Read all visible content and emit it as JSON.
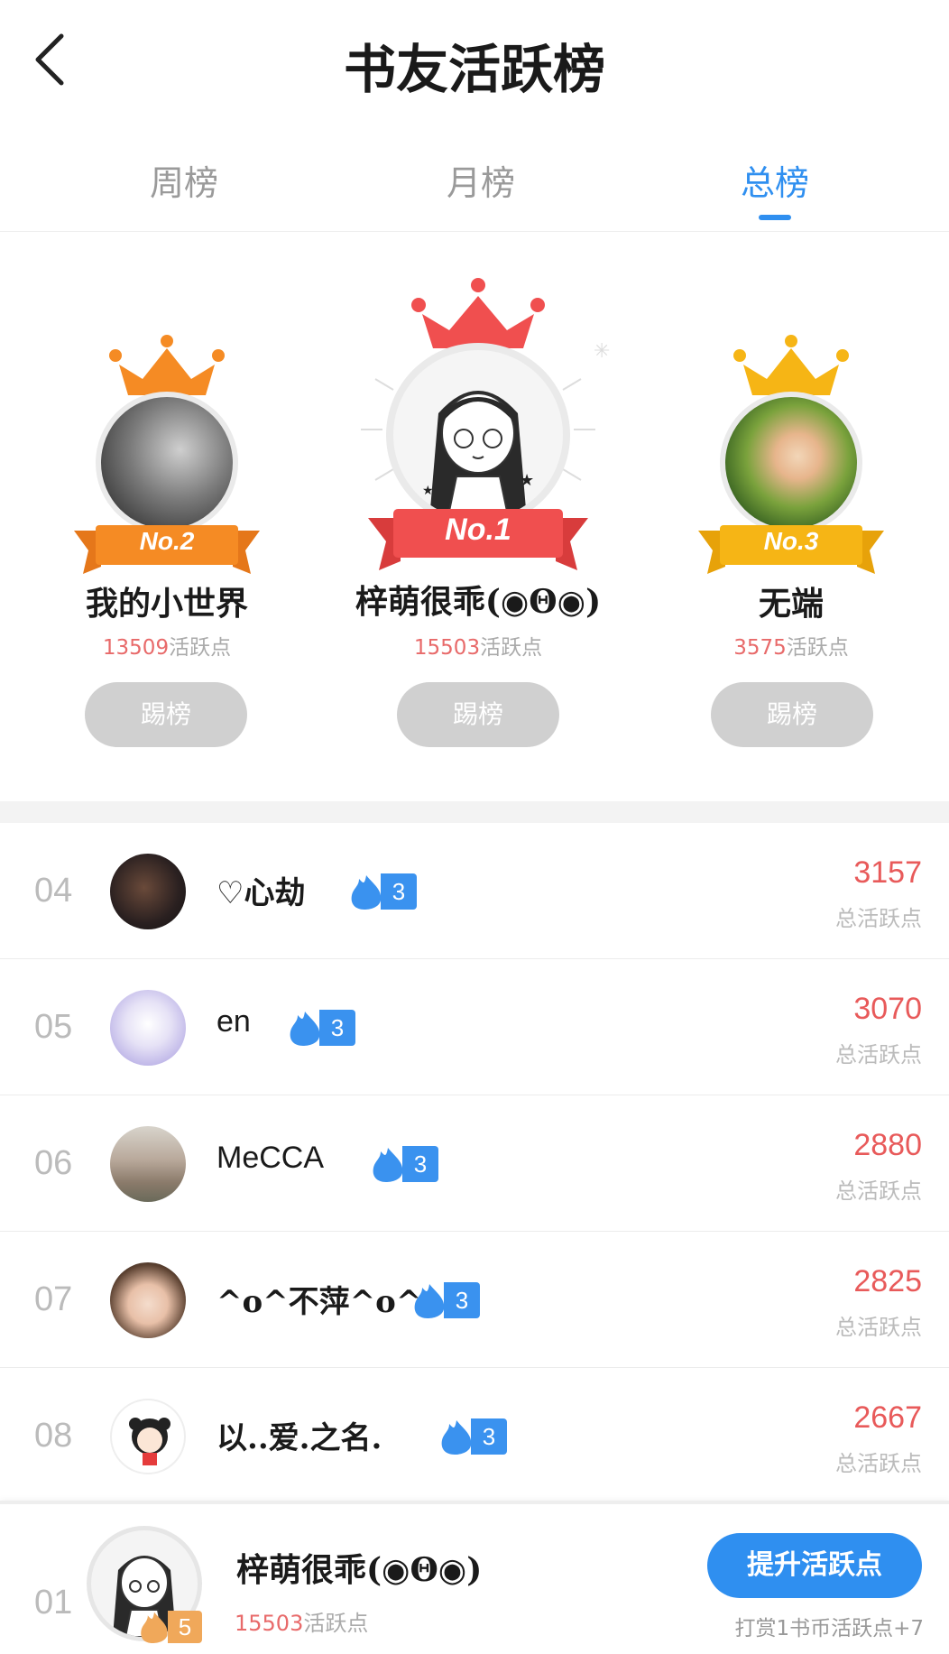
{
  "header": {
    "title": "书友活跃榜",
    "back_icon": "chevron-left-icon"
  },
  "tabs": [
    {
      "label": "周榜",
      "active": false
    },
    {
      "label": "月榜",
      "active": false
    },
    {
      "label": "总榜",
      "active": true
    }
  ],
  "podium": [
    {
      "place": 2,
      "badge": "No.2",
      "name": "我的小世界",
      "score": "13509",
      "unit": "活跃点",
      "button": "踢榜",
      "color": "#f58b24"
    },
    {
      "place": 1,
      "badge": "No.1",
      "name": "梓萌很乖(◉Θ◉)",
      "score": "15503",
      "unit": "活跃点",
      "button": "踢榜",
      "color": "#f04f4f"
    },
    {
      "place": 3,
      "badge": "No.3",
      "name": "无端",
      "score": "3575",
      "unit": "活跃点",
      "button": "踢榜",
      "color": "#f6b515"
    }
  ],
  "list": [
    {
      "rank": "04",
      "name": "♡心劫",
      "level": "3",
      "score": "3157",
      "unit": "总活跃点"
    },
    {
      "rank": "05",
      "name": "en",
      "level": "3",
      "score": "3070",
      "unit": "总活跃点"
    },
    {
      "rank": "06",
      "name": "MeCCA",
      "level": "3",
      "score": "2880",
      "unit": "总活跃点"
    },
    {
      "rank": "07",
      "name": "^o^不萍^o^",
      "level": "3",
      "score": "2825",
      "unit": "总活跃点"
    },
    {
      "rank": "08",
      "name": "以..爱.之名.",
      "level": "3",
      "score": "2667",
      "unit": "总活跃点"
    }
  ],
  "me": {
    "rank": "01",
    "name": "梓萌很乖(◉Θ◉)",
    "level": "5",
    "score": "15503",
    "unit": "活跃点",
    "boost_button": "提升活跃点",
    "tip": "打赏1书币活跃点+7"
  },
  "colors": {
    "accent": "#2f8ff0",
    "score": "#e85a5a",
    "muted": "#bbbbbb"
  }
}
